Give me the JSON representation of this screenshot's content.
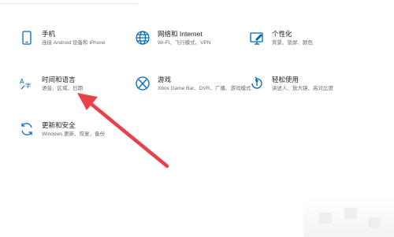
{
  "settings": {
    "tiles": [
      {
        "title": "手机",
        "desc": "连接 Android 设备和 iPhone",
        "icon": "phone-icon"
      },
      {
        "title": "网络和 Internet",
        "desc": "Wi-Fi、飞行模式、VPN",
        "icon": "globe-icon"
      },
      {
        "title": "个性化",
        "desc": "背景、锁屏、颜色",
        "icon": "personalization-icon"
      },
      {
        "title": "时间和语言",
        "desc": "语音、区域、日期",
        "icon": "time-language-icon"
      },
      {
        "title": "游戏",
        "desc": "Xbox Game Bar、DVR、广播、游戏模式",
        "icon": "xbox-icon"
      },
      {
        "title": "轻松使用",
        "desc": "讲述人、放大镜、高对比度",
        "icon": "ease-of-access-icon"
      },
      {
        "title": "更新和安全",
        "desc": "Windows 更新、恢复、备份",
        "icon": "update-icon"
      }
    ]
  },
  "colors": {
    "accent": "#0067b8",
    "arrow": "#e8414a",
    "text": "#1b1b1b",
    "subtext": "#6b6b6b"
  }
}
